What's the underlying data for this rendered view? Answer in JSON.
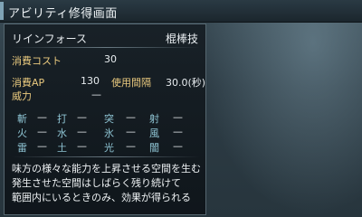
{
  "window": {
    "title": "アビリティ修得画面"
  },
  "ability": {
    "name": "リインフォース",
    "type": "棍棒技"
  },
  "stats": {
    "cost_label": "消費コスト",
    "cost_value": "30",
    "ap_label": "消費AP",
    "ap_value": "130",
    "interval_label": "使用間隔",
    "interval_value": "30.0(秒)",
    "power_label": "威力",
    "power_value": "—"
  },
  "elements": [
    [
      {
        "name": "斬",
        "value": "—"
      },
      {
        "name": "打",
        "value": "—"
      },
      {
        "name": "突",
        "value": "—"
      },
      {
        "name": "射",
        "value": "—"
      }
    ],
    [
      {
        "name": "火",
        "value": "—"
      },
      {
        "name": "水",
        "value": "—"
      },
      {
        "name": "氷",
        "value": "—"
      },
      {
        "name": "風",
        "value": "—"
      }
    ],
    [
      {
        "name": "雷",
        "value": "—"
      },
      {
        "name": "土",
        "value": "—"
      },
      {
        "name": "光",
        "value": "—"
      },
      {
        "name": "闇",
        "value": "—"
      }
    ]
  ],
  "description": {
    "line1": "味方の様々な能力を上昇させる空間を生む",
    "line2": "発生させた空間はしばらく残り続けて",
    "line3": "範囲内にいるときのみ、効果が得られる"
  },
  "colors": {
    "label_gold": "#e9c97e",
    "element_cyan": "#8fc5d4",
    "title_accent": "#7fa3b5"
  }
}
